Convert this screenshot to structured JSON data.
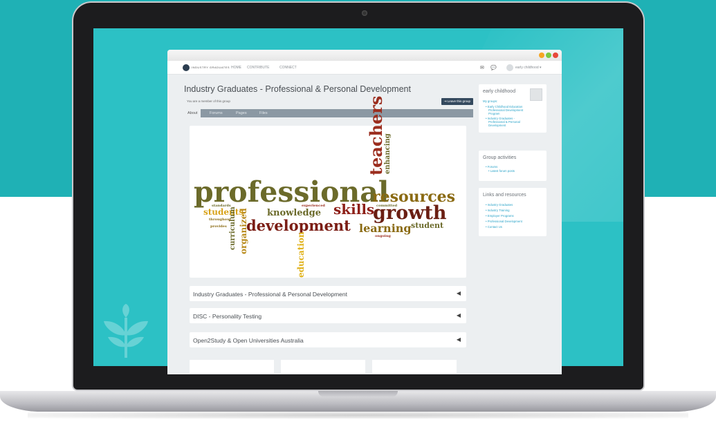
{
  "colors": {
    "teal": "#1fb1b5",
    "screen_bg": "#2cc1c5",
    "link": "#2aa3c8",
    "tab_bar": "#8b98a3",
    "button": "#34495e"
  },
  "window": {
    "traffic_lights": [
      "#f6a623",
      "#7ac943",
      "#e8493b"
    ]
  },
  "nav": {
    "logo_text": "INDUSTRY GRADUATES",
    "items": [
      "HOME",
      "CONTRIBUTE",
      "CONNECT"
    ],
    "icons": [
      "mail-icon",
      "chat-icon"
    ],
    "user": "early childhood ▾"
  },
  "page": {
    "title": "Industry Graduates - Professional & Personal Development",
    "member_text": "You are a member of this group",
    "leave_button": "Leave this group",
    "tabs": [
      "About",
      "Forums",
      "Pages",
      "Files"
    ]
  },
  "wordcloud": {
    "words": [
      {
        "text": "professional",
        "color": "#6b6a2a"
      },
      {
        "text": "development",
        "color": "#7b1d14"
      },
      {
        "text": "teachers",
        "color": "#9b2d1e"
      },
      {
        "text": "resources",
        "color": "#8a6a12"
      },
      {
        "text": "growth",
        "color": "#6a1e12"
      },
      {
        "text": "skills",
        "color": "#8d1f18"
      },
      {
        "text": "learning",
        "color": "#8a6a12"
      },
      {
        "text": "knowledge",
        "color": "#6b6a2a"
      },
      {
        "text": "students",
        "color": "#d8a219"
      },
      {
        "text": "organized",
        "color": "#b88a1a"
      },
      {
        "text": "education",
        "color": "#e0b21c"
      },
      {
        "text": "student",
        "color": "#6b6a2a"
      },
      {
        "text": "enhancing",
        "color": "#6b6a2a"
      },
      {
        "text": "curriculum",
        "color": "#6b6a2a"
      },
      {
        "text": "committed",
        "color": "#6b6a2a"
      },
      {
        "text": "experienced",
        "color": "#9b2d1e"
      },
      {
        "text": "standards",
        "color": "#6b6a2a"
      },
      {
        "text": "ongoing",
        "color": "#9b2d1e"
      },
      {
        "text": "throughout",
        "color": "#8a6a12"
      },
      {
        "text": "provides",
        "color": "#8a6a12"
      }
    ]
  },
  "sections": [
    "Industry Graduates - Professional & Personal Development",
    "DISC - Personality Testing",
    "Open2Study & Open Universities Australia"
  ],
  "sidebar": {
    "profile_name": "early childhood",
    "my_groups_label": "My groups:",
    "groups": [
      [
        "Early Childhood Education",
        "Professional Development",
        "Program"
      ],
      [
        "Industry Graduates -",
        "Professional & Personal",
        "Development"
      ]
    ],
    "activities_title": "Group activities",
    "activities": [
      "Forums"
    ],
    "activities_sub": [
      "Latest forum posts"
    ],
    "links_title": "Links and resources",
    "links": [
      "Industry Graduates",
      "Industry Training",
      "Employer Programs",
      "Professional Development",
      "Contact Us"
    ]
  }
}
